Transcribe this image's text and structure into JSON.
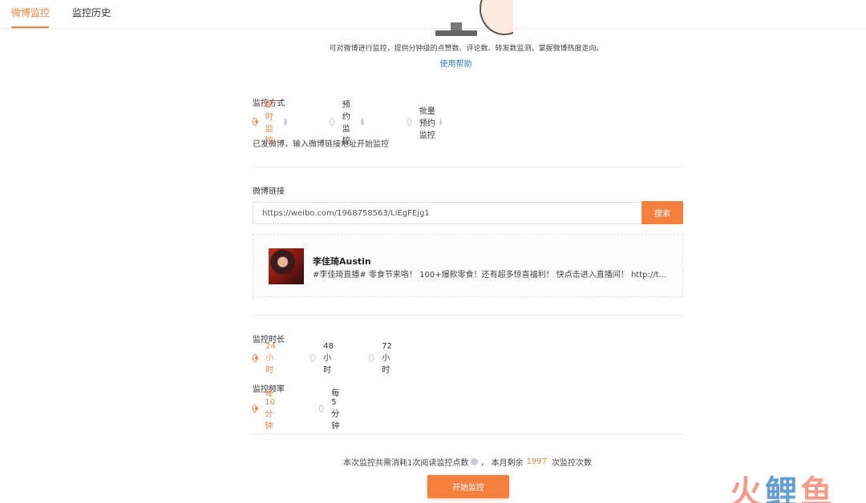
{
  "tabs": [
    {
      "label": "微博监控",
      "active": true
    },
    {
      "label": "监控历史",
      "active": false
    }
  ],
  "hero": {
    "description": "可对微博进行监控，提供分钟级的点赞数、评论数、转发数监测，掌握微博热度走向。",
    "help_link": "使用帮助"
  },
  "mode": {
    "label": "监控方式",
    "options": [
      "即时监控",
      "预约监控",
      "批量预约监控"
    ],
    "selected": "即时监控",
    "hint": "已发微博，输入微博链接地址开始监控"
  },
  "link": {
    "label": "微博链接",
    "value": "https://weibo.com/1968758563/LiEgFEjg1",
    "search_label": "搜索"
  },
  "result": {
    "author": "李佳琦Austin",
    "text": "#李佳琦直播# 零食节来咯！ 100+爆款零食！还有超多惊喜福利！ 快点击进入直播间！ http://t..."
  },
  "duration": {
    "label": "监控时长",
    "options": [
      "24小时",
      "48小时",
      "72小时"
    ],
    "selected": "24小时"
  },
  "frequency": {
    "label": "监控频率",
    "options": [
      "每10分钟",
      "每5分钟"
    ],
    "selected": "每10分钟"
  },
  "footer": {
    "cost_prefix": "本次监控共需消耗1次阅读监控点数",
    "cost_middle": "，  本月剩余",
    "remaining": "1997",
    "cost_suffix": "次监控次数",
    "start_label": "开始监控"
  },
  "watermark": {
    "chars": [
      "火",
      "鲤",
      "鱼"
    ]
  },
  "colors": {
    "accent": "#f5803e",
    "link": "#2b7bd8"
  }
}
